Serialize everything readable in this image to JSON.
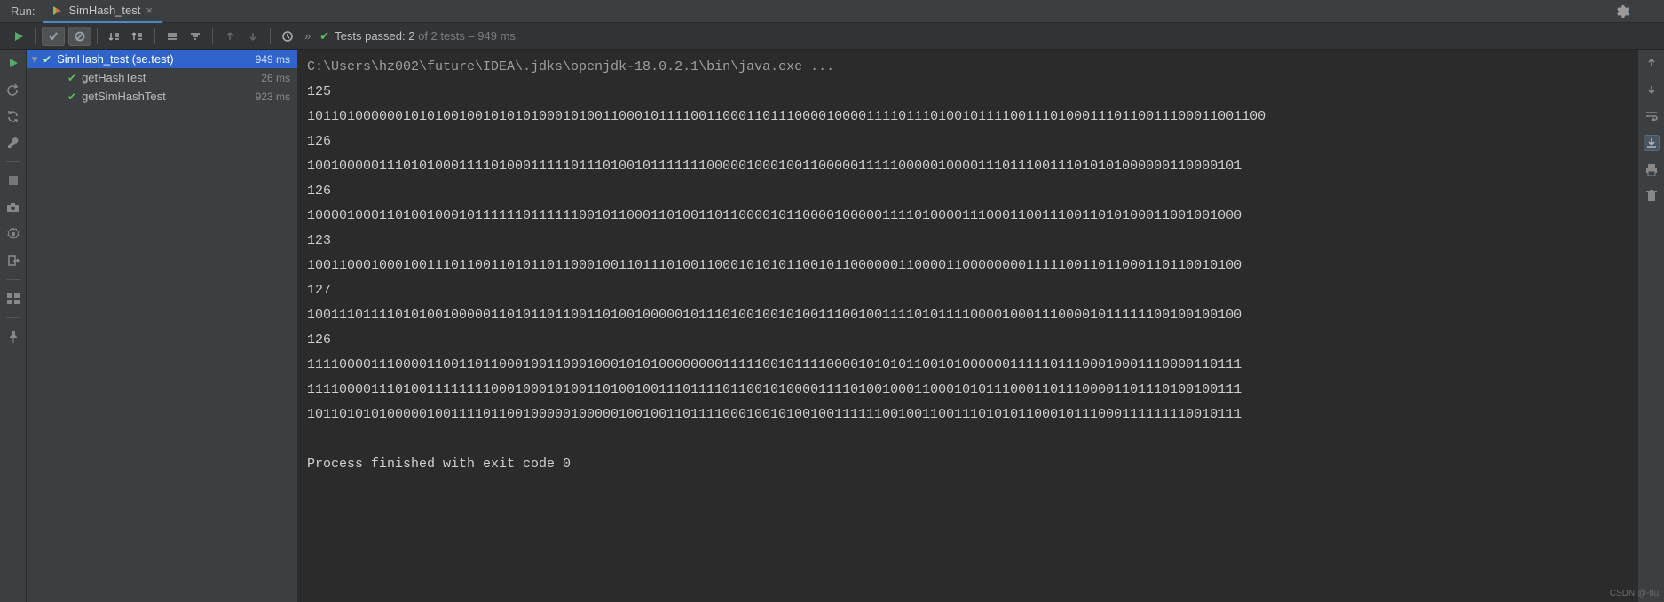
{
  "tabbar": {
    "run_label": "Run:",
    "tab_label": "SimHash_test"
  },
  "toolbar": {
    "tests_passed_prefix": "Tests passed: ",
    "tests_passed_count": "2",
    "tests_total_suffix": " of 2 tests – 949 ms"
  },
  "tree": {
    "root": {
      "name": "SimHash_test (se.test)",
      "time": "949 ms"
    },
    "children": [
      {
        "name": "getHashTest",
        "time": "26 ms"
      },
      {
        "name": "getSimHashTest",
        "time": "923 ms"
      }
    ]
  },
  "console": {
    "cmd": "C:\\Users\\hz002\\future\\IDEA\\.jdks\\openjdk-18.0.2.1\\bin\\java.exe ...",
    "lines": [
      "125",
      "101101000000101010010010101010001010011000101111001100011011100001000011110111010010111100111010001110110011100011001100",
      "126",
      "100100000111010100011110100011111011101001011111110000010001001100000111110000010000111011100111010101000000110000101",
      "126",
      "100001000110100100010111111011111100101100011010011011000010110000100000111101000011100011001110011010100011001001000",
      "123",
      "100110001000100111011001101011011000100110111010011000101010110010110000001100001100000000111110011011000110110010100",
      "127",
      "100111011110101001000001101011011001101001000001011101001001010011100100111101011110000100011100001011111100100100100",
      "126",
      "111100001110000110011011000100110001000101010000000011111001011110000101010110010100000011111011100010001110000110111",
      "111100001110100111111110001000101001101001001110111101100101000011110100100011000101011100011011100001101110100100111",
      "101101010100000100111101100100000100000100100110111100010010100100111111001001100111010101100010111000111111110010111",
      "",
      "Process finished with exit code 0"
    ]
  },
  "watermark": "CSDN @-tiu"
}
